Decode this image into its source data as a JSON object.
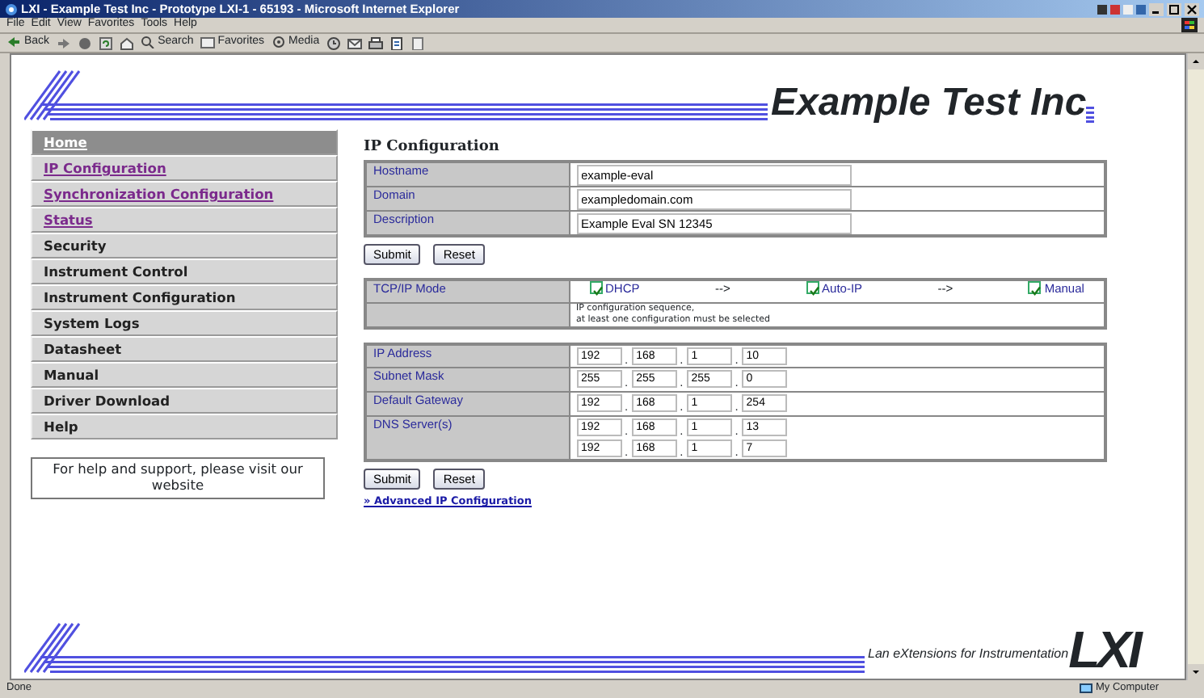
{
  "window": {
    "title": "LXI - Example Test Inc - Prototype LXI-1 - 65193 - Microsoft Internet Explorer"
  },
  "menu": [
    "File",
    "Edit",
    "View",
    "Favorites",
    "Tools",
    "Help"
  ],
  "toolbar": [
    {
      "kind": "back",
      "label": "Back"
    },
    {
      "kind": "forward"
    },
    {
      "kind": "stop"
    },
    {
      "kind": "refresh"
    },
    {
      "kind": "home"
    },
    {
      "kind": "search",
      "label": "Search"
    },
    {
      "kind": "favorites",
      "label": "Favorites"
    },
    {
      "kind": "media",
      "label": "Media"
    },
    {
      "kind": "history"
    },
    {
      "kind": "mail"
    },
    {
      "kind": "print"
    },
    {
      "kind": "edit"
    },
    {
      "kind": "page"
    }
  ],
  "header": {
    "company": "Example Test Inc"
  },
  "sidebar": {
    "items": [
      {
        "label": "Home",
        "kind": "link",
        "selected": true
      },
      {
        "label": "IP Configuration",
        "kind": "link",
        "selected": false
      },
      {
        "label": "Synchronization Configuration",
        "kind": "link",
        "selected": false
      },
      {
        "label": "Status",
        "kind": "link",
        "selected": false
      },
      {
        "label": "Security",
        "kind": "plain",
        "selected": false
      },
      {
        "label": "Instrument Control",
        "kind": "plain",
        "selected": false
      },
      {
        "label": "Instrument Configuration",
        "kind": "plain",
        "selected": false
      },
      {
        "label": "System Logs",
        "kind": "plain",
        "selected": false
      },
      {
        "label": "Datasheet",
        "kind": "plain",
        "selected": false
      },
      {
        "label": "Manual",
        "kind": "plain",
        "selected": false
      },
      {
        "label": "Driver Download",
        "kind": "plain",
        "selected": false
      },
      {
        "label": "Help",
        "kind": "plain",
        "selected": false
      }
    ],
    "help_box": "For help and support, please visit our website"
  },
  "main": {
    "title": "IP Configuration",
    "identity": [
      {
        "label": "Hostname",
        "value": "example-eval"
      },
      {
        "label": "Domain",
        "value": "exampledomain.com"
      },
      {
        "label": "Description",
        "value": "Example Eval SN 12345"
      }
    ],
    "buttons": [
      "Submit",
      "Reset"
    ],
    "tcpip": {
      "label": "TCP/IP Mode",
      "options": [
        {
          "label": "DHCP",
          "checked": true
        },
        {
          "label": "Auto-IP",
          "checked": true
        },
        {
          "label": "Manual",
          "checked": true
        }
      ],
      "arrow": "-->",
      "note": [
        "IP configuration sequence,",
        "at least one configuration must be selected"
      ]
    },
    "network": [
      {
        "label": "IP Address",
        "addresses": [
          [
            "192",
            "168",
            "1",
            "10"
          ]
        ]
      },
      {
        "label": "Subnet Mask",
        "addresses": [
          [
            "255",
            "255",
            "255",
            "0"
          ]
        ]
      },
      {
        "label": "Default Gateway",
        "addresses": [
          [
            "192",
            "168",
            "1",
            "254"
          ]
        ]
      },
      {
        "label": "DNS Server(s)",
        "addresses": [
          [
            "192",
            "168",
            "1",
            "13"
          ],
          [
            "192",
            "168",
            "1",
            "7"
          ]
        ]
      }
    ],
    "octet_separator": ".",
    "buttons_2": [
      "Submit",
      "Reset"
    ],
    "advanced_link": "» Advanced IP Configuration"
  },
  "footer": {
    "tagline": "Lan eXtensions for Instrumentation",
    "logo": "LXI"
  },
  "status_bar": {
    "text": "Done",
    "zone": "My Computer"
  }
}
